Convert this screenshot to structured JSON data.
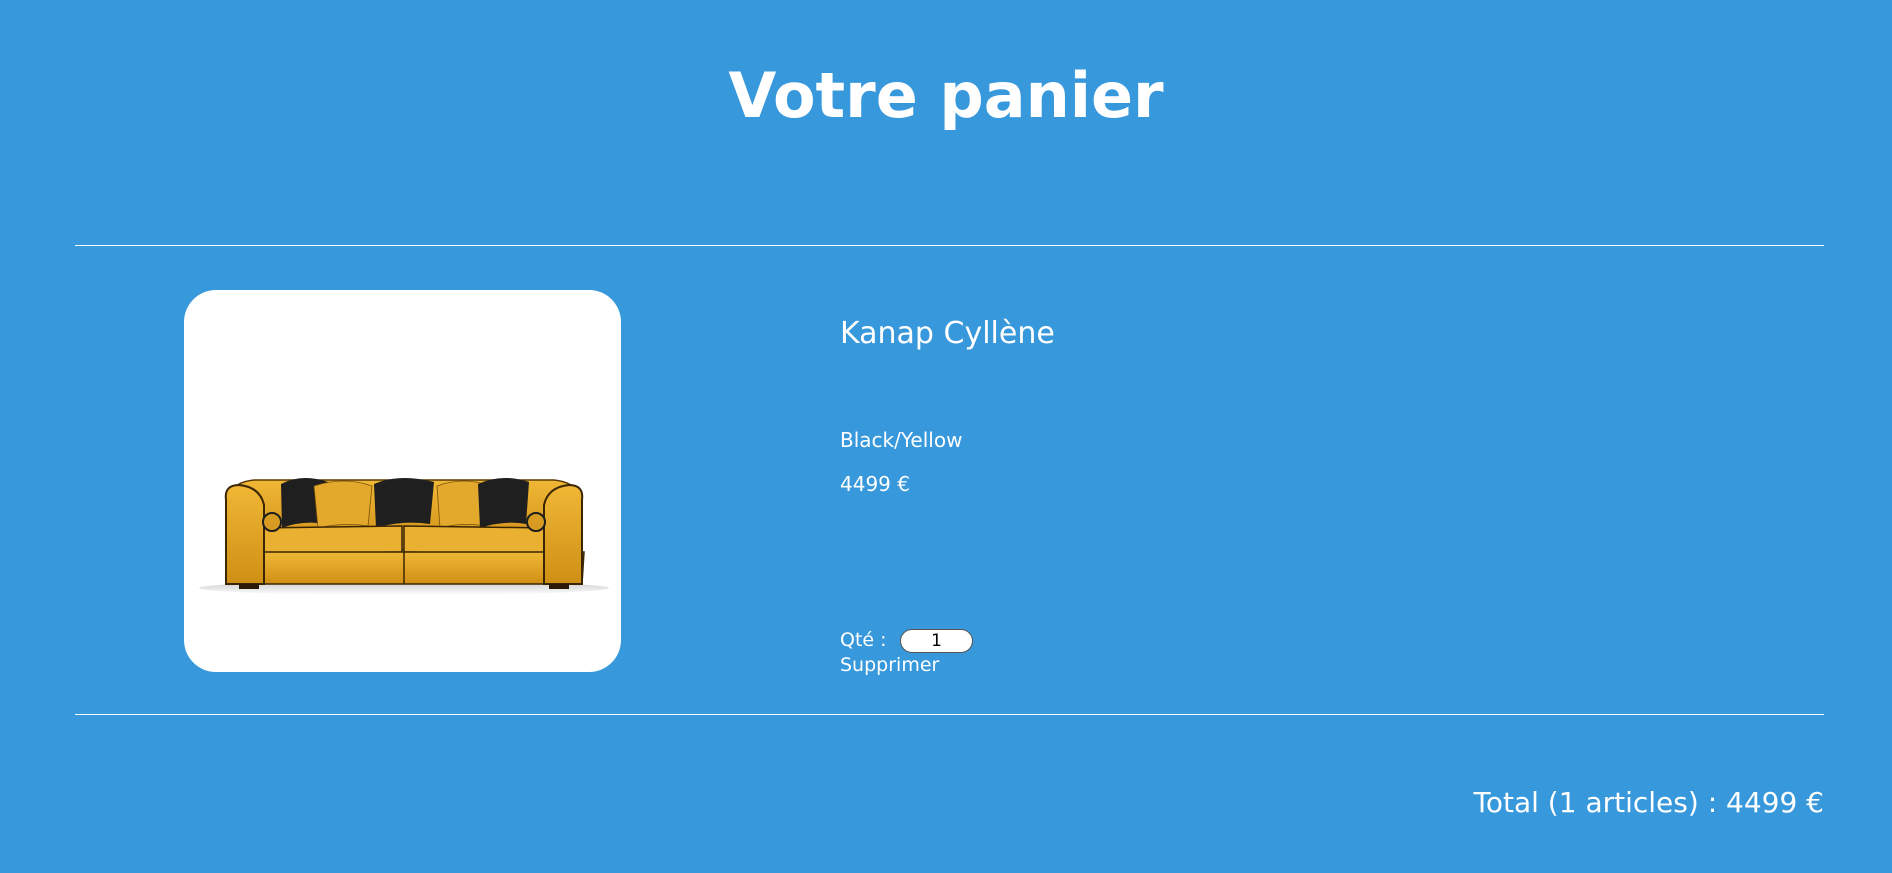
{
  "page": {
    "title": "Votre panier"
  },
  "cart": {
    "items": [
      {
        "name": "Kanap Cyllène",
        "color": "Black/Yellow",
        "price": "4499 €",
        "quantity_label": "Qté :",
        "quantity_value": "1",
        "delete_label": "Supprimer",
        "image": "yellow-sofa-with-black-cushions"
      }
    ],
    "total_label": "Total (1 articles) : 4499 €"
  },
  "colors": {
    "background": "#3798dc",
    "text": "#ffffff",
    "card": "#ffffff",
    "sofa": "#e0a321",
    "cushion_dark": "#1e1e1e"
  }
}
